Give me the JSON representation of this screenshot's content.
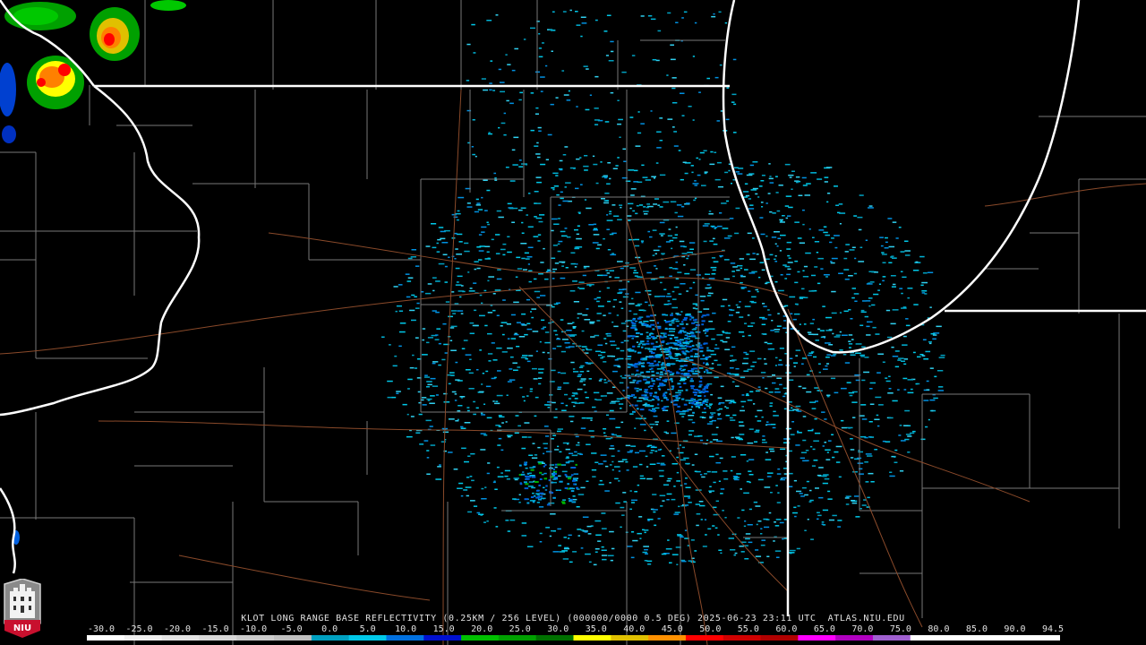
{
  "product": {
    "title": "KLOT LONG RANGE BASE REFLECTIVITY (0.25KM / 256 LEVEL) (000000/0000 0.5 DEG) 2025-06-23 23:11 UTC  ATLAS.NIU.EDU"
  },
  "logo": {
    "text": "NIU",
    "icon": "niu-logo-icon"
  },
  "scale": {
    "labels": [
      "-30.0",
      "-25.0",
      "-20.0",
      "-15.0",
      "-10.0",
      "-5.0",
      "0.0",
      "5.0",
      "10.0",
      "15.0",
      "20.0",
      "25.0",
      "30.0",
      "35.0",
      "40.0",
      "45.0",
      "50.0",
      "55.0",
      "60.0",
      "65.0",
      "70.0",
      "75.0",
      "80.0",
      "85.0",
      "90.0",
      "94.5"
    ],
    "colors": [
      "#ffffff",
      "#f0f0f0",
      "#e4e4e4",
      "#d8d8d8",
      "#cccccc",
      "#c0c0c0",
      "#00a0c0",
      "#00c8e8",
      "#0070e0",
      "#0010d0",
      "#00c000",
      "#00a000",
      "#007000",
      "#ffff00",
      "#e0c000",
      "#ff9000",
      "#ff0000",
      "#d00000",
      "#b00000",
      "#ff00ff",
      "#b000c0",
      "#a060d0",
      "#ffffff",
      "#ffffff",
      "#ffffff",
      "#ffffff"
    ]
  }
}
